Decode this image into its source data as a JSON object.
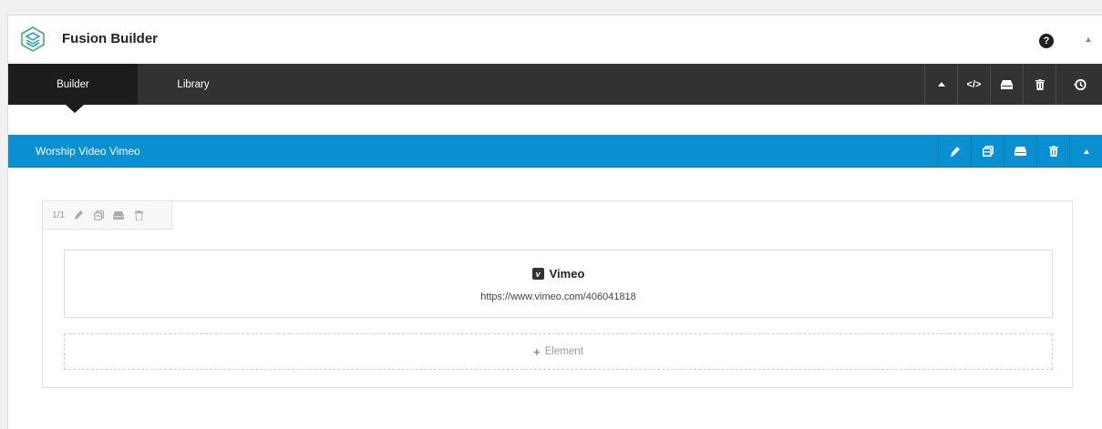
{
  "app": {
    "title": "Fusion Builder",
    "help_glyph": "?"
  },
  "tabs": [
    {
      "label": "Builder",
      "active": true
    },
    {
      "label": "Library",
      "active": false
    }
  ],
  "toolbar": {
    "icons": [
      "collapse-all-icon",
      "code-icon",
      "save-icon",
      "trash-icon",
      "history-icon"
    ]
  },
  "section": {
    "title": "Worship Video Vimeo",
    "icons": [
      "edit-icon",
      "clone-icon",
      "save-icon",
      "trash-icon",
      "collapse-icon"
    ]
  },
  "column": {
    "ratio": "1/1",
    "icons": [
      "edit-icon",
      "clone-icon",
      "save-icon",
      "trash-icon"
    ]
  },
  "element": {
    "badge": "v",
    "name": "Vimeo",
    "url": "https://www.vimeo.com/406041818"
  },
  "add_element": {
    "plus": "+",
    "label": "Element"
  },
  "colors": {
    "tabbar": "#323232",
    "tab_active": "#1d1d1d",
    "section": "#0a8fd0"
  }
}
